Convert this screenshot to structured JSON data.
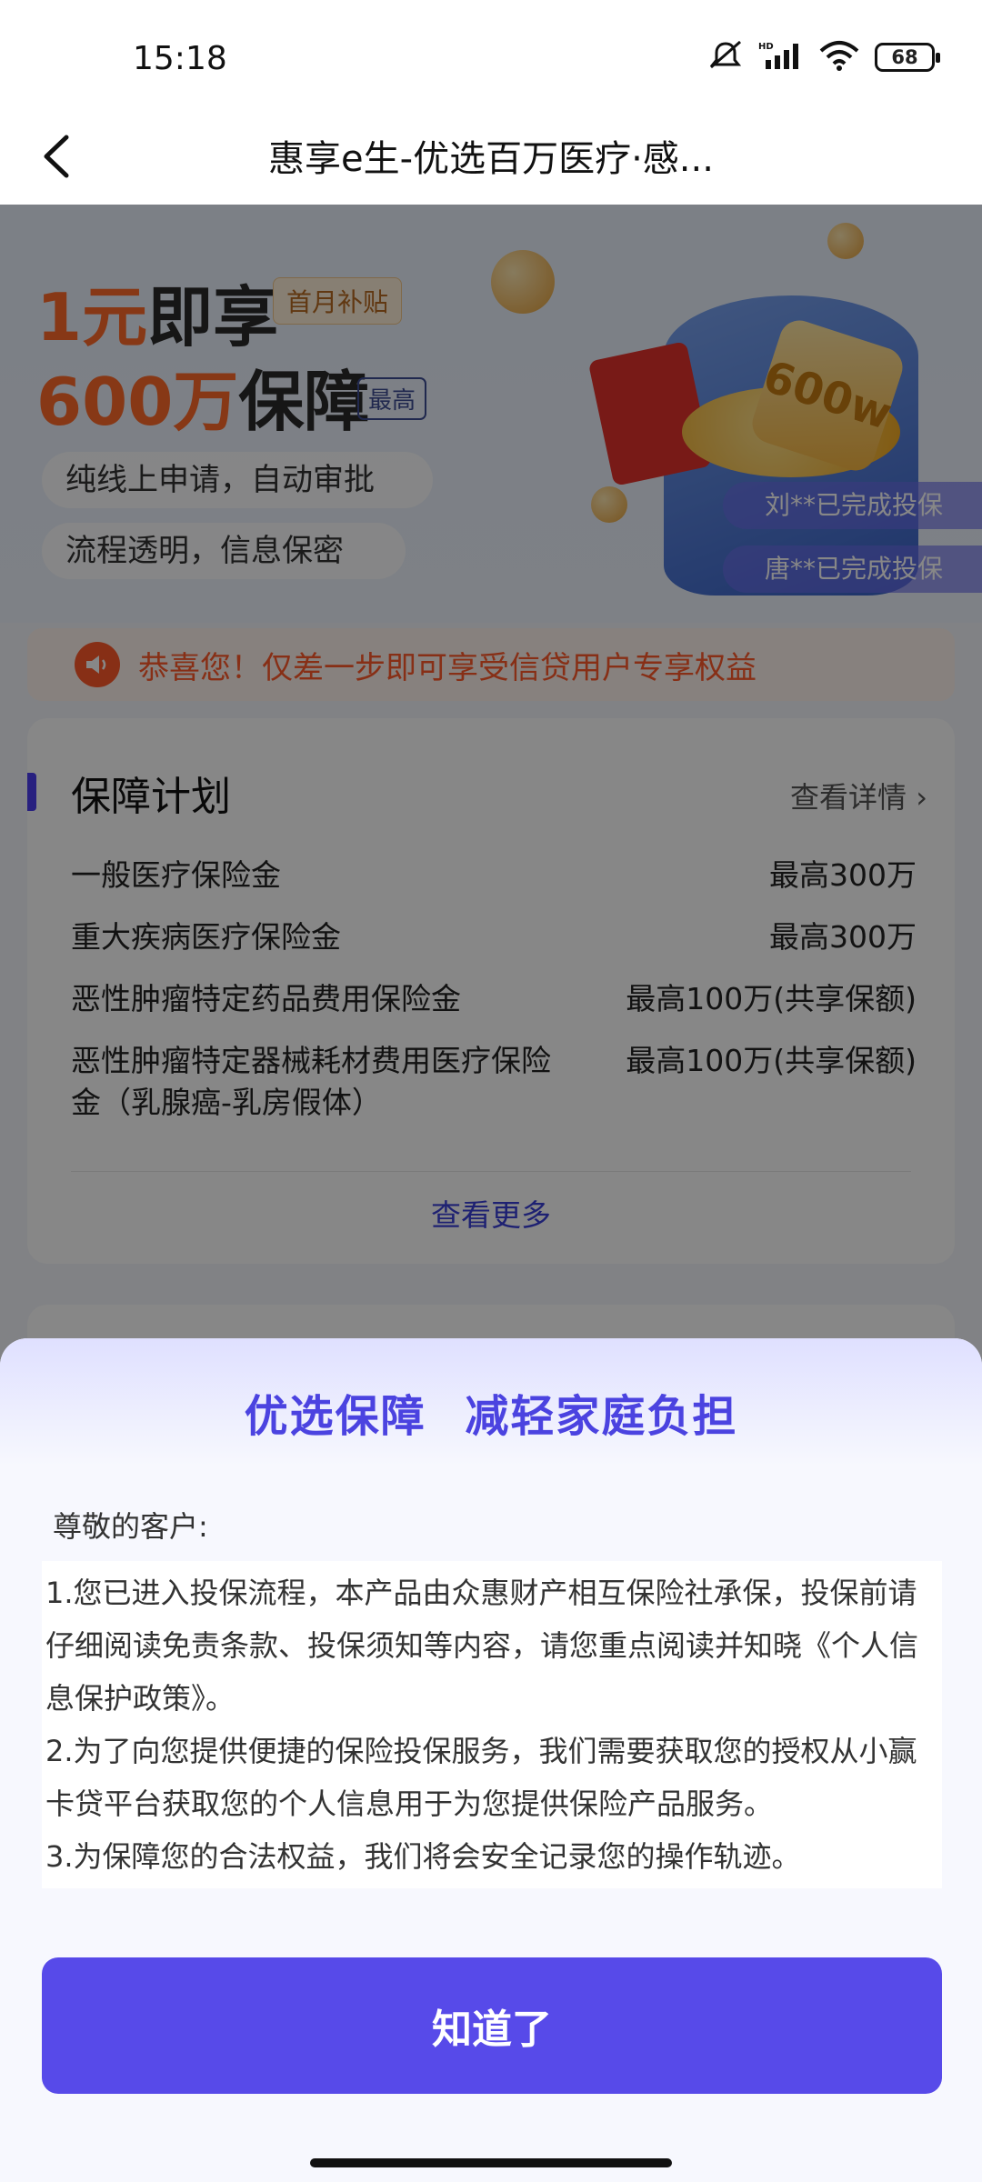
{
  "status_bar": {
    "time": "15:18",
    "battery": "68"
  },
  "nav": {
    "title": "惠享e生-优选百万医疗·感..."
  },
  "hero": {
    "line1_accent": "1元",
    "line1_rest": "即享",
    "tag": "首月补贴",
    "line2_accent": "600万",
    "line2_rest": "保障",
    "tag2": "最高",
    "pill1": "纯线上申请，自动审批",
    "pill2": "流程透明，信息保密",
    "badge": "600w",
    "tickers": [
      "刘**已完成投保",
      "唐**已完成投保"
    ]
  },
  "notice": {
    "text": "恭喜您！仅差一步即可享受信贷用户专享权益"
  },
  "plan": {
    "title": "保障计划",
    "detail_link": "查看详情",
    "rows": [
      {
        "name": "一般医疗保险金",
        "amount": "最高300万"
      },
      {
        "name": "重大疾病医疗保险金",
        "amount": "最高300万"
      },
      {
        "name": "恶性肿瘤特定药品费用保险金",
        "amount": "最高100万(共享保额)"
      },
      {
        "name": "恶性肿瘤特定器械耗材费用医疗保险金（乳腺癌-乳房假体）",
        "amount": "最高100万(共享保额)"
      }
    ],
    "more": "查看更多"
  },
  "sheet": {
    "title": "优选保障  减轻家庭负担",
    "greeting": "尊敬的客户:",
    "paragraphs": [
      "1.您已进入投保流程，本产品由众惠财产相互保险社承保，投保前请仔细阅读免责条款、投保须知等内容，请您重点阅读并知晓《个人信息保护政策》。",
      "2.为了向您提供便捷的保险投保服务，我们需要获取您的授权从小赢卡贷平台获取您的个人信息用于为您提供保险产品服务。",
      "3.为保障您的合法权益，我们将会安全记录您的操作轨迹。"
    ],
    "button": "知道了"
  },
  "colors": {
    "primary": "#574ae9",
    "accent_orange": "#ff6a2a",
    "notice": "#ff5a2a",
    "link": "#3a3fd8"
  }
}
